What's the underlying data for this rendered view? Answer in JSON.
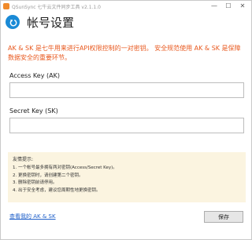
{
  "window": {
    "title": "QSunSync 七牛云文件同步工具 v2.1.1.0",
    "minimize_glyph": "—",
    "maximize_glyph": "☐",
    "close_glyph": "✕"
  },
  "header": {
    "back_icon": "back-arrow-icon",
    "title": "帐号设置",
    "accent_color": "#1a8ad6"
  },
  "notice": {
    "text": "AK & SK 是七牛用来进行API权限控制的一对密钥。 安全规范使用 AK & SK 是保障数据安全的重要环节。",
    "color": "#e8581e"
  },
  "form": {
    "access_key_label": "Access Key (AK)",
    "access_key_value": "",
    "secret_key_label": "Secret Key (SK)",
    "secret_key_value": ""
  },
  "tips": {
    "title": "友情提示:",
    "items": [
      "1. 一个帐号最多拥有两对密钥(Access/Secret Key)。",
      "2. 更换密钥时，请创建第二个密钥。",
      "3. 删除密钥前请停用。",
      "4. 出于安全考虑，建议您周期性地更换密钥。"
    ]
  },
  "footer": {
    "view_keys_link": "查看我的 AK & SK",
    "save_label": "保存"
  }
}
